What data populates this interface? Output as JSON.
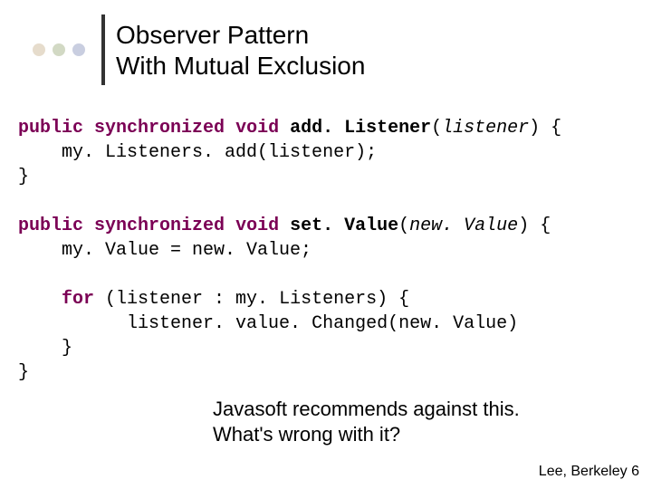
{
  "title_line1": "Observer Pattern",
  "title_line2": "With Mutual Exclusion",
  "code": {
    "kw_public": "public",
    "kw_sync": "synchronized",
    "kw_void": "void",
    "kw_for": "for",
    "fn_add": "add. Listener",
    "param_listener": "listener",
    "line_add_body": "my. Listeners. add(listener);",
    "close_brace": "}",
    "fn_set": "set. Value",
    "param_newval": "new. Value",
    "line_set_assign": "my. Value = new. Value;",
    "for_head": " (listener : my. Listeners) {",
    "for_body": "listener. value. Changed(new. Value)"
  },
  "note_line1": "Javasoft recommends against this.",
  "note_line2": "What's wrong with it?",
  "footer_author": "Lee, Berkeley",
  "footer_page": "6"
}
